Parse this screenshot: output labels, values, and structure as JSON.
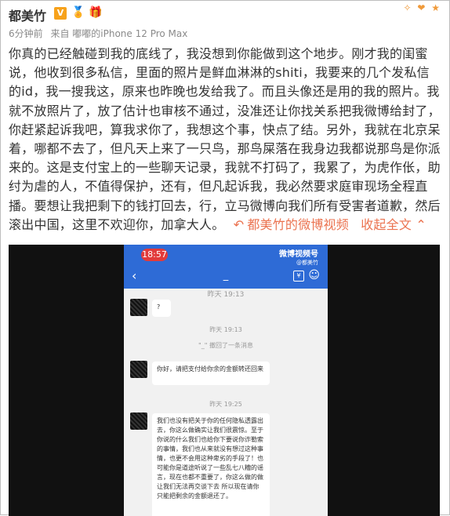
{
  "post": {
    "author": "都美竹",
    "verified_badge": "V",
    "time": "6分钟前",
    "source": "来自 嘟嘟的iPhone 12 Pro Max",
    "content": "你真的已经触碰到我的底线了，我没想到你能做到这个地步。刚才我的闺蜜说，他收到很多私信，里面的照片是鲜血淋淋的shiti，我要来的几个发私信的id，我一搜我这，原来也昨晚也发给我了。而且头像还是用的我的照片。我就不放照片了，放了估计也审核不通过，没准还让你找关系把我微博给封了，你赶紧起诉我吧，算我求你了，我想这个事，快点了结。另外，我就在北京呆着，哪都不去了，但凡天上来了一只鸟，那鸟屎落在我身边我都说那鸟是你派来的。这是支付宝上的一些聊天记录，我就不打码了，我累了，为虎作伥，助纣为虐的人，不值得保护，还有，但凡起诉我，我必然要求庭审现场全程直播。要想让我把剩下的钱打回去，行，立马微博向我们所有受害者道歉，然后滚出中国，这里不欢迎你，加拿大人。",
    "video_link": "都美竹的微博视频",
    "collapse": "收起全文",
    "collapse_icon": "chevron-up-icon"
  },
  "screenshot": {
    "status_time": "18:57",
    "watermark": "微博视频号",
    "watermark_sub": "@都美竹",
    "nav_title": "_",
    "cut_text": "昨天 19:13",
    "msg1": "?",
    "time1": "昨天 19:13",
    "recall": "\"_\" 撤回了一条消息",
    "msg2": "你好，请把支付给你余的金额转还回来",
    "time2": "昨天 19:25",
    "msg3": "我们也没有把关于你的任何隐私透露出去，你这么做确实让我们很震惊。至于你说的什么我们也给你下要说你诈勒索的事情，我们也从来就没有想过这种事情，也更不会用这种卑劣的手段了！也可能你是道途听说了一些乱七八糟的谣言，现在也都不重要了，你这么做的做让我们无法再交谈下去  所以现在请你只能把剩余的金额退还了。"
  }
}
